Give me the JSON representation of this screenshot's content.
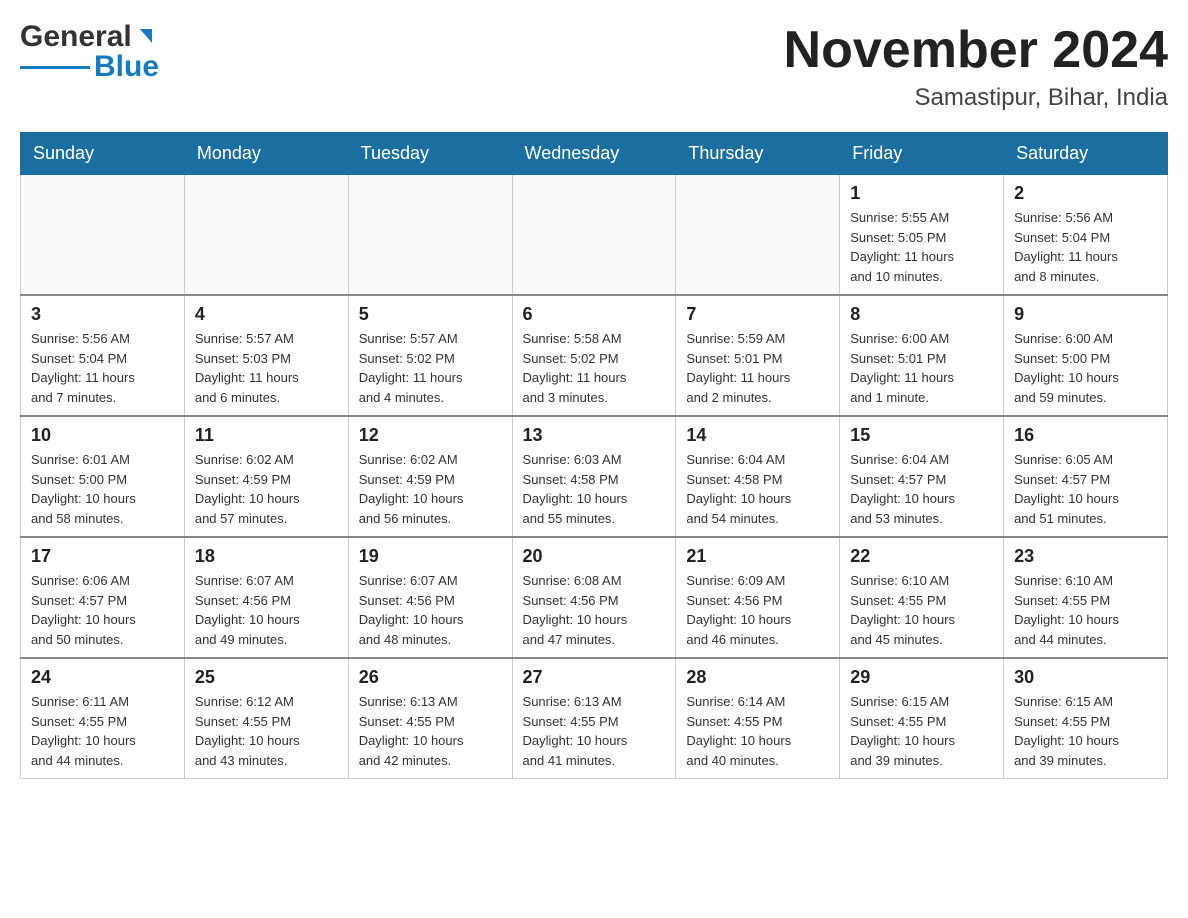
{
  "header": {
    "logo": {
      "general_text": "General",
      "blue_text": "Blue"
    },
    "title": "November 2024",
    "location": "Samastipur, Bihar, India"
  },
  "weekdays": [
    "Sunday",
    "Monday",
    "Tuesday",
    "Wednesday",
    "Thursday",
    "Friday",
    "Saturday"
  ],
  "weeks": [
    [
      {
        "day": "",
        "info": ""
      },
      {
        "day": "",
        "info": ""
      },
      {
        "day": "",
        "info": ""
      },
      {
        "day": "",
        "info": ""
      },
      {
        "day": "",
        "info": ""
      },
      {
        "day": "1",
        "info": "Sunrise: 5:55 AM\nSunset: 5:05 PM\nDaylight: 11 hours\nand 10 minutes."
      },
      {
        "day": "2",
        "info": "Sunrise: 5:56 AM\nSunset: 5:04 PM\nDaylight: 11 hours\nand 8 minutes."
      }
    ],
    [
      {
        "day": "3",
        "info": "Sunrise: 5:56 AM\nSunset: 5:04 PM\nDaylight: 11 hours\nand 7 minutes."
      },
      {
        "day": "4",
        "info": "Sunrise: 5:57 AM\nSunset: 5:03 PM\nDaylight: 11 hours\nand 6 minutes."
      },
      {
        "day": "5",
        "info": "Sunrise: 5:57 AM\nSunset: 5:02 PM\nDaylight: 11 hours\nand 4 minutes."
      },
      {
        "day": "6",
        "info": "Sunrise: 5:58 AM\nSunset: 5:02 PM\nDaylight: 11 hours\nand 3 minutes."
      },
      {
        "day": "7",
        "info": "Sunrise: 5:59 AM\nSunset: 5:01 PM\nDaylight: 11 hours\nand 2 minutes."
      },
      {
        "day": "8",
        "info": "Sunrise: 6:00 AM\nSunset: 5:01 PM\nDaylight: 11 hours\nand 1 minute."
      },
      {
        "day": "9",
        "info": "Sunrise: 6:00 AM\nSunset: 5:00 PM\nDaylight: 10 hours\nand 59 minutes."
      }
    ],
    [
      {
        "day": "10",
        "info": "Sunrise: 6:01 AM\nSunset: 5:00 PM\nDaylight: 10 hours\nand 58 minutes."
      },
      {
        "day": "11",
        "info": "Sunrise: 6:02 AM\nSunset: 4:59 PM\nDaylight: 10 hours\nand 57 minutes."
      },
      {
        "day": "12",
        "info": "Sunrise: 6:02 AM\nSunset: 4:59 PM\nDaylight: 10 hours\nand 56 minutes."
      },
      {
        "day": "13",
        "info": "Sunrise: 6:03 AM\nSunset: 4:58 PM\nDaylight: 10 hours\nand 55 minutes."
      },
      {
        "day": "14",
        "info": "Sunrise: 6:04 AM\nSunset: 4:58 PM\nDaylight: 10 hours\nand 54 minutes."
      },
      {
        "day": "15",
        "info": "Sunrise: 6:04 AM\nSunset: 4:57 PM\nDaylight: 10 hours\nand 53 minutes."
      },
      {
        "day": "16",
        "info": "Sunrise: 6:05 AM\nSunset: 4:57 PM\nDaylight: 10 hours\nand 51 minutes."
      }
    ],
    [
      {
        "day": "17",
        "info": "Sunrise: 6:06 AM\nSunset: 4:57 PM\nDaylight: 10 hours\nand 50 minutes."
      },
      {
        "day": "18",
        "info": "Sunrise: 6:07 AM\nSunset: 4:56 PM\nDaylight: 10 hours\nand 49 minutes."
      },
      {
        "day": "19",
        "info": "Sunrise: 6:07 AM\nSunset: 4:56 PM\nDaylight: 10 hours\nand 48 minutes."
      },
      {
        "day": "20",
        "info": "Sunrise: 6:08 AM\nSunset: 4:56 PM\nDaylight: 10 hours\nand 47 minutes."
      },
      {
        "day": "21",
        "info": "Sunrise: 6:09 AM\nSunset: 4:56 PM\nDaylight: 10 hours\nand 46 minutes."
      },
      {
        "day": "22",
        "info": "Sunrise: 6:10 AM\nSunset: 4:55 PM\nDaylight: 10 hours\nand 45 minutes."
      },
      {
        "day": "23",
        "info": "Sunrise: 6:10 AM\nSunset: 4:55 PM\nDaylight: 10 hours\nand 44 minutes."
      }
    ],
    [
      {
        "day": "24",
        "info": "Sunrise: 6:11 AM\nSunset: 4:55 PM\nDaylight: 10 hours\nand 44 minutes."
      },
      {
        "day": "25",
        "info": "Sunrise: 6:12 AM\nSunset: 4:55 PM\nDaylight: 10 hours\nand 43 minutes."
      },
      {
        "day": "26",
        "info": "Sunrise: 6:13 AM\nSunset: 4:55 PM\nDaylight: 10 hours\nand 42 minutes."
      },
      {
        "day": "27",
        "info": "Sunrise: 6:13 AM\nSunset: 4:55 PM\nDaylight: 10 hours\nand 41 minutes."
      },
      {
        "day": "28",
        "info": "Sunrise: 6:14 AM\nSunset: 4:55 PM\nDaylight: 10 hours\nand 40 minutes."
      },
      {
        "day": "29",
        "info": "Sunrise: 6:15 AM\nSunset: 4:55 PM\nDaylight: 10 hours\nand 39 minutes."
      },
      {
        "day": "30",
        "info": "Sunrise: 6:15 AM\nSunset: 4:55 PM\nDaylight: 10 hours\nand 39 minutes."
      }
    ]
  ]
}
